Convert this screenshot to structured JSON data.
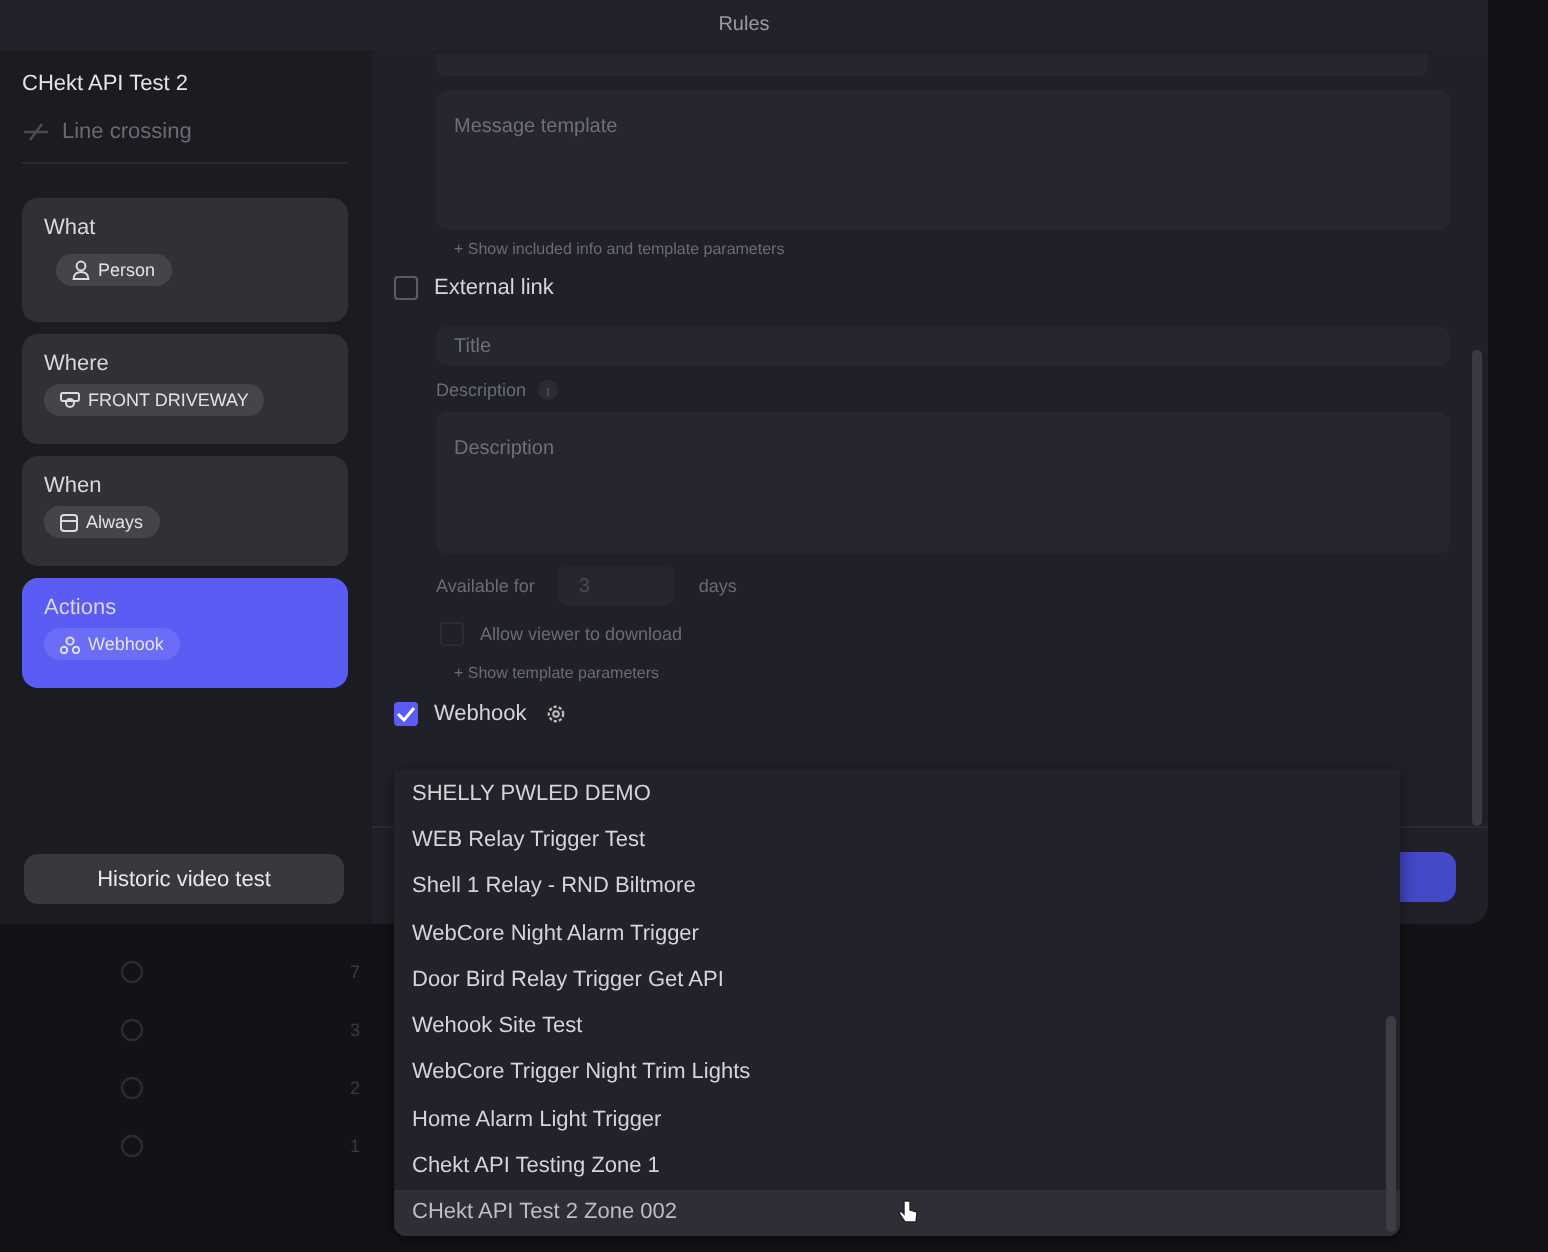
{
  "window": {
    "title": "Rules"
  },
  "sidebar": {
    "rule_name": "CHekt API Test 2",
    "trigger": "Line crossing",
    "steps": [
      {
        "label": "What",
        "value": "Person",
        "selected": false
      },
      {
        "label": "Where",
        "value": "FRONT DRIVEWAY",
        "selected": false
      },
      {
        "label": "When",
        "value": "Always",
        "selected": false
      },
      {
        "label": "Actions",
        "value": "Webhook",
        "selected": true
      }
    ],
    "button": "Historic video test"
  },
  "form": {
    "message_template": {
      "placeholder": "Message template"
    },
    "message_hint": "+ Show included info and template parameters",
    "external_link": {
      "label": "External link",
      "checked": false,
      "title": {
        "placeholder": "Title"
      },
      "description_label": "Description",
      "description": {
        "placeholder": "Description"
      },
      "available_label": "Available for",
      "available_value": "3",
      "available_unit": "days",
      "allow_download": {
        "label": "Allow viewer to download",
        "checked": false
      },
      "template_hint": "+ Show template parameters"
    },
    "webhook": {
      "label": "Webhook",
      "checked": true
    }
  },
  "webhook_dropdown": {
    "items": [
      {
        "label": "SHELLY PWLED DEMO",
        "hovered": false
      },
      {
        "label": "WEB Relay Trigger Test",
        "hovered": false
      },
      {
        "label": "Shell 1 Relay - RND Biltmore",
        "hovered": false
      },
      {
        "label": "WebCore Night Alarm Trigger",
        "hovered": false
      },
      {
        "label": "Door Bird Relay Trigger Get API",
        "hovered": false
      },
      {
        "label": "Wehook Site Test",
        "hovered": false
      },
      {
        "label": "WebCore Trigger Night Trim Lights",
        "hovered": false
      },
      {
        "label": "Home Alarm Light Trigger",
        "hovered": false
      },
      {
        "label": "Chekt API Testing Zone 1",
        "hovered": false
      },
      {
        "label": "CHekt API Test 2 Zone 002",
        "hovered": true
      }
    ]
  },
  "background_list": {
    "rows": [
      {
        "count": "7"
      },
      {
        "count": "3"
      },
      {
        "count": "2"
      },
      {
        "count": "1"
      }
    ]
  }
}
